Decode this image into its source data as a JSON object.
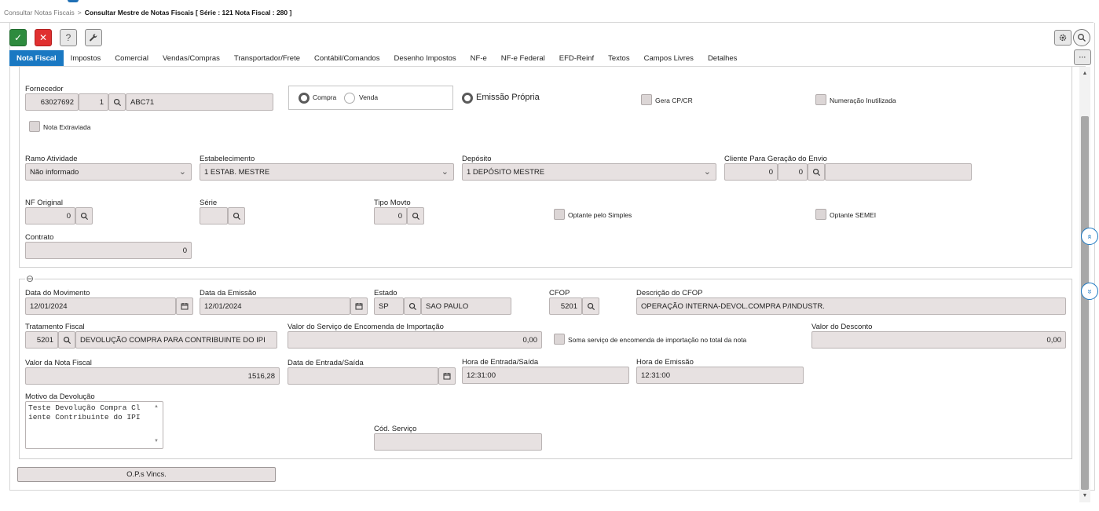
{
  "breadcrumb": {
    "parent": "Consultar Notas Fiscais",
    "separator": ">",
    "current": "Consultar Mestre de Notas Fiscais [ Série : 121 Nota Fiscal : 280 ]"
  },
  "toolbar": {
    "confirm_icon": "✓",
    "cancel_icon": "✕",
    "help_icon": "?",
    "tools_icon": "🔧",
    "settings_icon": "⚙",
    "search_icon": "🔍",
    "more_icon": "···"
  },
  "tabs": [
    {
      "label": "Nota Fiscal",
      "active": true
    },
    {
      "label": "Impostos"
    },
    {
      "label": "Comercial"
    },
    {
      "label": "Vendas/Compras"
    },
    {
      "label": "Transportador/Frete"
    },
    {
      "label": "Contábil/Comandos"
    },
    {
      "label": "Desenho Impostos"
    },
    {
      "label": "NF-e"
    },
    {
      "label": "NF-e Federal"
    },
    {
      "label": "EFD-Reinf"
    },
    {
      "label": "Textos"
    },
    {
      "label": "Campos Livres"
    },
    {
      "label": "Detalhes"
    }
  ],
  "header_section": {
    "fornecedor": {
      "label": "Fornecedor",
      "code": "63027692",
      "seq": "1",
      "name": "ABC71"
    },
    "tipo": {
      "compra": "Compra",
      "venda": "Venda",
      "selected": "Compra"
    },
    "emissao_propria": "Emissão Própria",
    "gera_cp_cr": "Gera CP/CR",
    "numeracao_inutilizada": "Numeração Inutilizada",
    "nota_extraviada": "Nota Extraviada",
    "ramo_atividade": {
      "label": "Ramo Atividade",
      "value": "Não informado"
    },
    "estabelecimento": {
      "label": "Estabelecimento",
      "value": "1 ESTAB. MESTRE"
    },
    "deposito": {
      "label": "Depósito",
      "value": "1 DEPÓSITO MESTRE"
    },
    "cliente_envio": {
      "label": "Cliente Para Geração do Envio",
      "v1": "0",
      "v2": "0",
      "v3": ""
    },
    "nf_original": {
      "label": "NF Original",
      "value": "0"
    },
    "serie": {
      "label": "Série",
      "value": ""
    },
    "tipo_movto": {
      "label": "Tipo Movto",
      "value": "0"
    },
    "optante_simples": "Optante pelo Simples",
    "optante_semei": "Optante SEMEI",
    "contrato": {
      "label": "Contrato",
      "value": "0"
    }
  },
  "detail_section": {
    "collapse_icon": "⊖",
    "data_movimento": {
      "label": "Data do Movimento",
      "value": "12/01/2024"
    },
    "data_emissao": {
      "label": "Data da Emissão",
      "value": "12/01/2024"
    },
    "estado": {
      "label": "Estado",
      "uf": "SP",
      "name": "SAO PAULO"
    },
    "cfop": {
      "label": "CFOP",
      "value": "5201"
    },
    "descricao_cfop": {
      "label": "Descrição do CFOP",
      "value": "OPERAÇÃO INTERNA-DEVOL.COMPRA P/INDUSTR."
    },
    "tratamento_fiscal": {
      "label": "Tratamento Fiscal",
      "code": "5201",
      "desc": "DEVOLUÇÃO COMPRA PARA CONTRIBUINTE DO IPI"
    },
    "valor_servico_encomenda": {
      "label": "Valor do Serviço de Encomenda de Importação",
      "value": "0,00"
    },
    "soma_servico": "Soma serviço de encomenda de importação no total da nota",
    "valor_desconto": {
      "label": "Valor do Desconto",
      "value": "0,00"
    },
    "valor_nota": {
      "label": "Valor da Nota Fiscal",
      "value": "1516,28"
    },
    "data_entrada_saida": {
      "label": "Data de Entrada/Saída",
      "value": ""
    },
    "hora_entrada_saida": {
      "label": "Hora de Entrada/Saída",
      "value": "12:31:00"
    },
    "hora_emissao": {
      "label": "Hora de Emissão",
      "value": "12:31:00"
    },
    "motivo_devolucao": {
      "label": "Motivo da Devolução",
      "value": "Teste Devolução Compra Cl\niente Contribuinte do IPI"
    },
    "cod_servico": {
      "label": "Cód. Serviço",
      "value": ""
    }
  },
  "ops_button": "O.P.s Vincs.",
  "side_buttons": {
    "up": "«",
    "down": "»"
  }
}
